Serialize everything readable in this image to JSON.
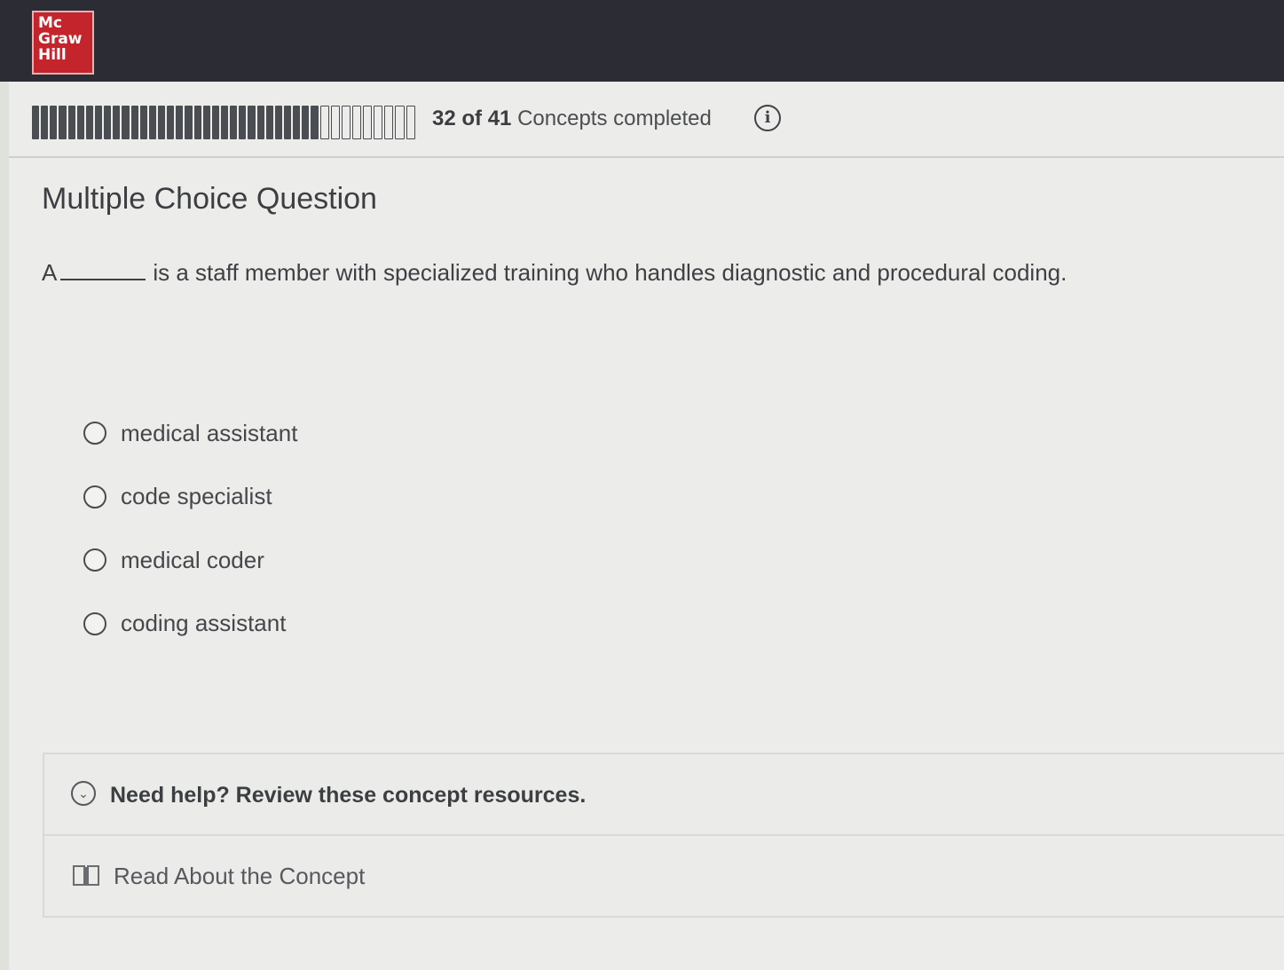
{
  "header": {
    "logo_lines": [
      "Mc",
      "Graw",
      "Hill"
    ]
  },
  "progress": {
    "completed": "32",
    "of_label": "of",
    "total": "41",
    "label": "Concepts completed",
    "fraction": 0.78
  },
  "question": {
    "title": "Multiple Choice Question",
    "prompt_prefix": "A",
    "prompt_suffix": "is a staff member with specialized training who handles diagnostic and procedural coding.",
    "options": [
      {
        "label": "medical assistant"
      },
      {
        "label": "code specialist"
      },
      {
        "label": "medical coder"
      },
      {
        "label": "coding assistant"
      }
    ]
  },
  "help": {
    "header": "Need help? Review these concept resources.",
    "read_link": "Read About the Concept",
    "icons": [
      "chevron-down-icon",
      "book-icon",
      "info-icon"
    ]
  }
}
